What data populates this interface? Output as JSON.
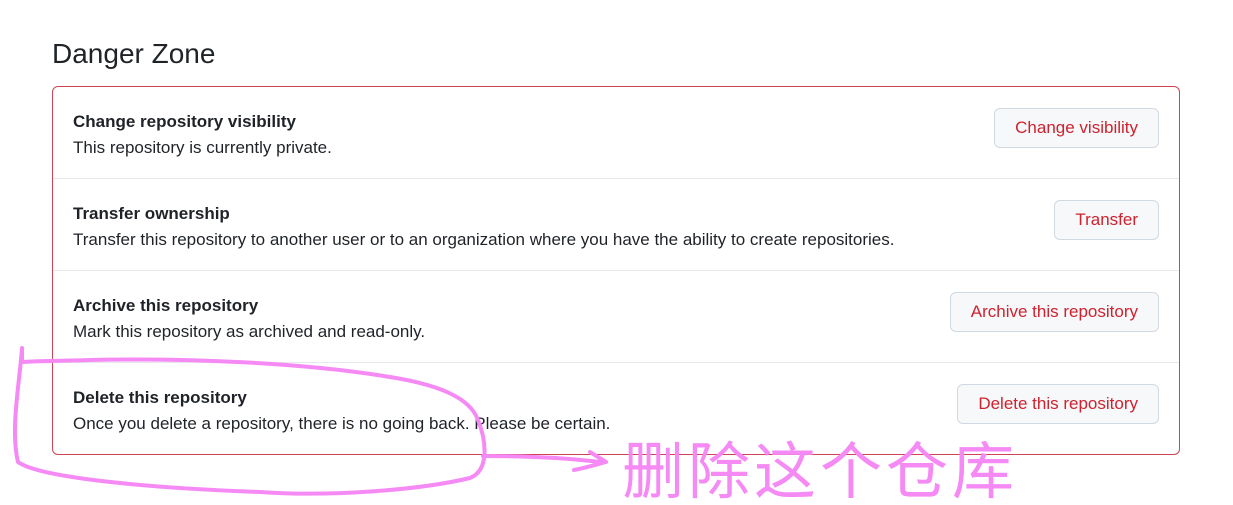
{
  "section": {
    "title": "Danger Zone"
  },
  "rows": [
    {
      "title": "Change repository visibility",
      "description": "This repository is currently private.",
      "button": "Change visibility"
    },
    {
      "title": "Transfer ownership",
      "description": "Transfer this repository to another user or to an organization where you have the ability to create repositories.",
      "button": "Transfer"
    },
    {
      "title": "Archive this repository",
      "description": "Mark this repository as archived and read-only.",
      "button": "Archive this repository"
    },
    {
      "title": "Delete this repository",
      "description": "Once you delete a repository, there is no going back. Please be certain.",
      "button": "Delete this repository"
    }
  ],
  "annotation": {
    "note": "删除这个仓库",
    "color": "#f58af5"
  },
  "colors": {
    "danger_border": "#cf4352",
    "danger_text": "#cf222e",
    "button_bg": "#f6f8fa",
    "divider": "#e6e8eb"
  }
}
